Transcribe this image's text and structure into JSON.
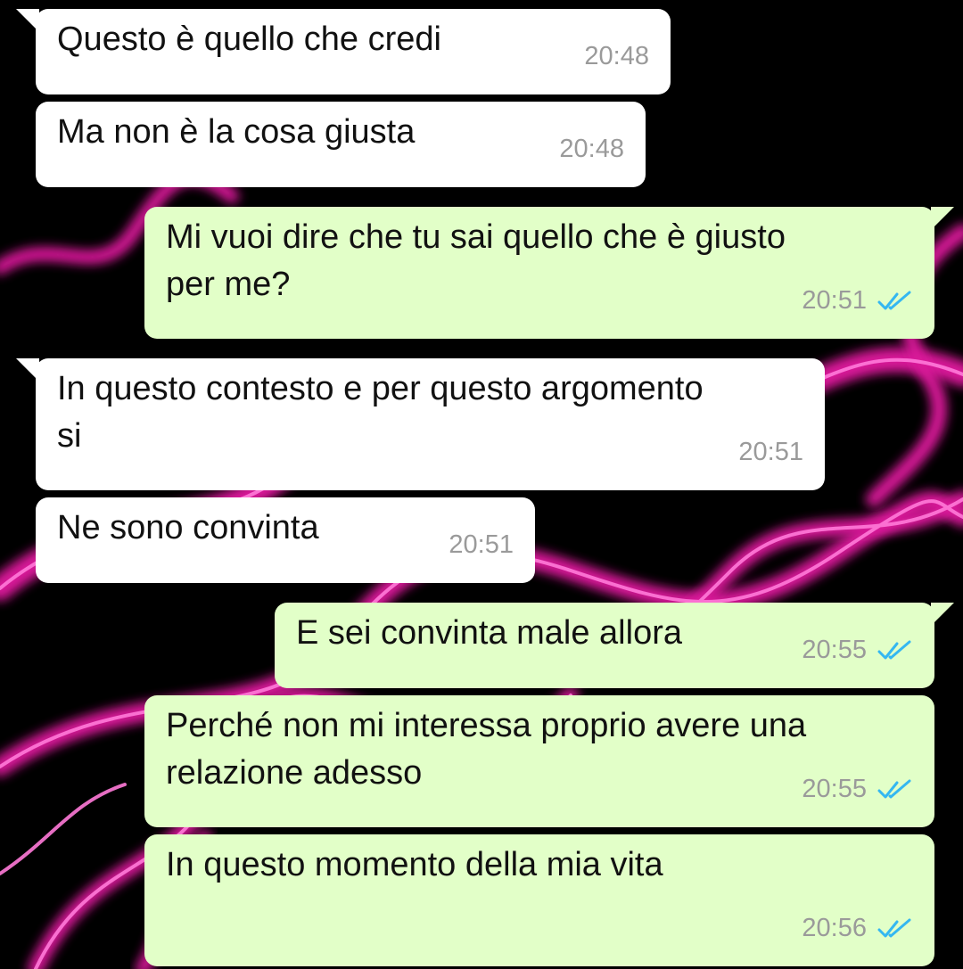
{
  "conversation": {
    "messages": [
      {
        "direction": "incoming",
        "text": "Questo è quello che credi",
        "time": "20:48"
      },
      {
        "direction": "incoming",
        "text": "Ma non è la cosa giusta",
        "time": "20:48"
      },
      {
        "direction": "outgoing",
        "text": "Mi vuoi dire che tu sai quello che è giusto\nper me?",
        "time": "20:51",
        "status": "read"
      },
      {
        "direction": "incoming",
        "text": "In questo contesto e per questo argomento\nsi",
        "time": "20:51"
      },
      {
        "direction": "incoming",
        "text": "Ne sono convinta",
        "time": "20:51"
      },
      {
        "direction": "outgoing",
        "text": "E sei convinta male allora",
        "time": "20:55",
        "status": "read"
      },
      {
        "direction": "outgoing",
        "text": "Perché non mi interessa proprio avere una\nrelazione adesso",
        "time": "20:55",
        "status": "read"
      },
      {
        "direction": "outgoing",
        "text": "In questo momento della mia vita",
        "time": "20:56",
        "status": "read"
      }
    ]
  },
  "icons": {
    "read_receipt": "double-check-icon"
  },
  "colors": {
    "incoming_bubble": "#ffffff",
    "outgoing_bubble": "#e2ffc8",
    "timestamp": "#9a9a9a",
    "read_check": "#34b7f1",
    "wallpaper_base": "#000000",
    "wallpaper_smoke": "#ff1fb4"
  }
}
